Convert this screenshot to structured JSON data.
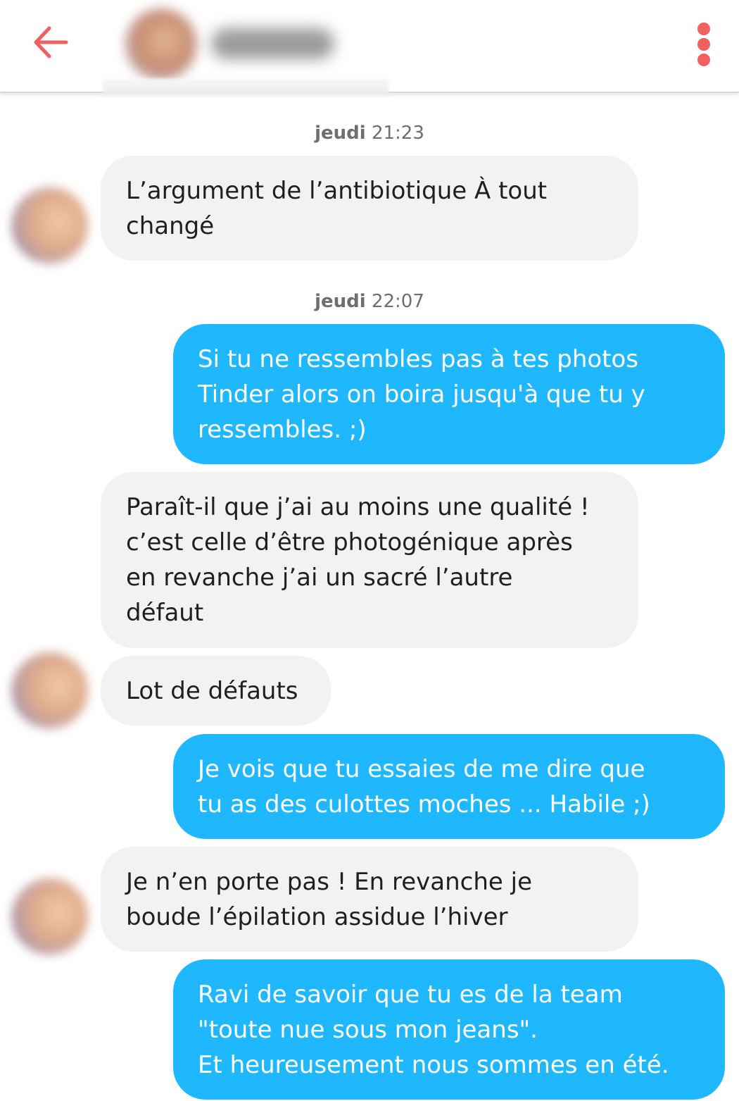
{
  "header": {
    "back_icon": "arrow-left-icon",
    "menu_icon": "more-vertical-icon",
    "accent_color": "#F0605E"
  },
  "colors": {
    "outgoing_bubble": "#1FB8FF",
    "incoming_bubble": "#F2F2F4"
  },
  "conversation": {
    "timestamps": [
      {
        "day": "jeudi",
        "time": "21:23"
      },
      {
        "day": "jeudi",
        "time": "22:07"
      }
    ],
    "messages": [
      {
        "sender": "them",
        "text": "L’argument de l’antibiotique À tout\nchangé"
      },
      {
        "sender": "me",
        "text": "Si tu ne ressembles pas à tes photos\nTinder alors on boira jusqu'à que tu y\nressembles. ;)"
      },
      {
        "sender": "them",
        "text": "Paraît-il que j’ai au moins une qualité !\nc’est celle d’être photogénique après\nen revanche j’ai un sacré l’autre\ndéfaut"
      },
      {
        "sender": "them",
        "text": "Lot de défauts"
      },
      {
        "sender": "me",
        "text": "Je vois que tu essaies de me dire que\ntu as des culottes moches ... Habile ;)"
      },
      {
        "sender": "them",
        "text": "Je n’en porte pas ! En revanche je\nboude l’épilation assidue l’hiver"
      },
      {
        "sender": "me",
        "text": "Ravi de savoir que tu es de la team\n\"toute nue sous mon jeans\".\nEt heureusement nous sommes en été."
      }
    ]
  }
}
